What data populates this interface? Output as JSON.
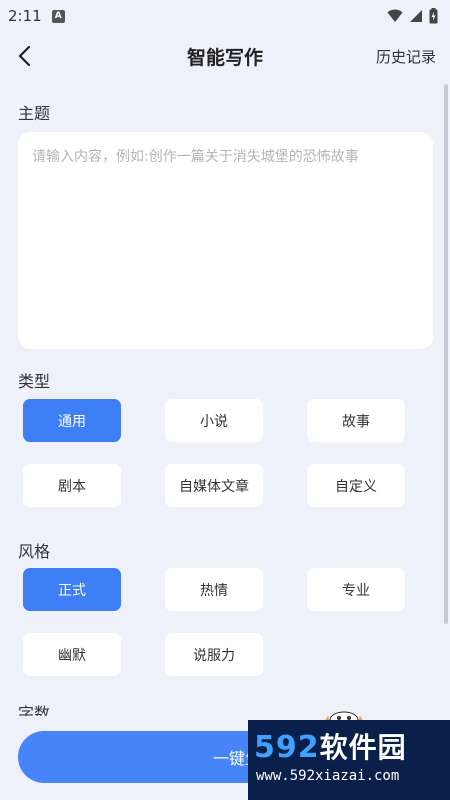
{
  "status_bar": {
    "time": "2:11",
    "notification_badge": "A"
  },
  "header": {
    "title": "智能写作",
    "history_label": "历史记录"
  },
  "topic": {
    "label": "主题",
    "value": "",
    "placeholder": "请输入内容，例如:创作一篇关于消失城堡的恐怖故事"
  },
  "type_section": {
    "label": "类型",
    "options": [
      "通用",
      "小说",
      "故事",
      "剧本",
      "自媒体文章",
      "自定义"
    ],
    "selected": "通用"
  },
  "style_section": {
    "label": "风格",
    "options": [
      "正式",
      "热情",
      "专业",
      "幽默",
      "说服力"
    ],
    "selected": "正式"
  },
  "word_count_section": {
    "label": "字数"
  },
  "generate_button": {
    "label": "一键生成"
  },
  "watermark": {
    "logo_number": "592",
    "logo_text": "软件园",
    "url": "www.592xiazai.com"
  },
  "colors": {
    "accent": "#3f7ff6",
    "background": "#eef1fa",
    "button": "#4684f8"
  }
}
